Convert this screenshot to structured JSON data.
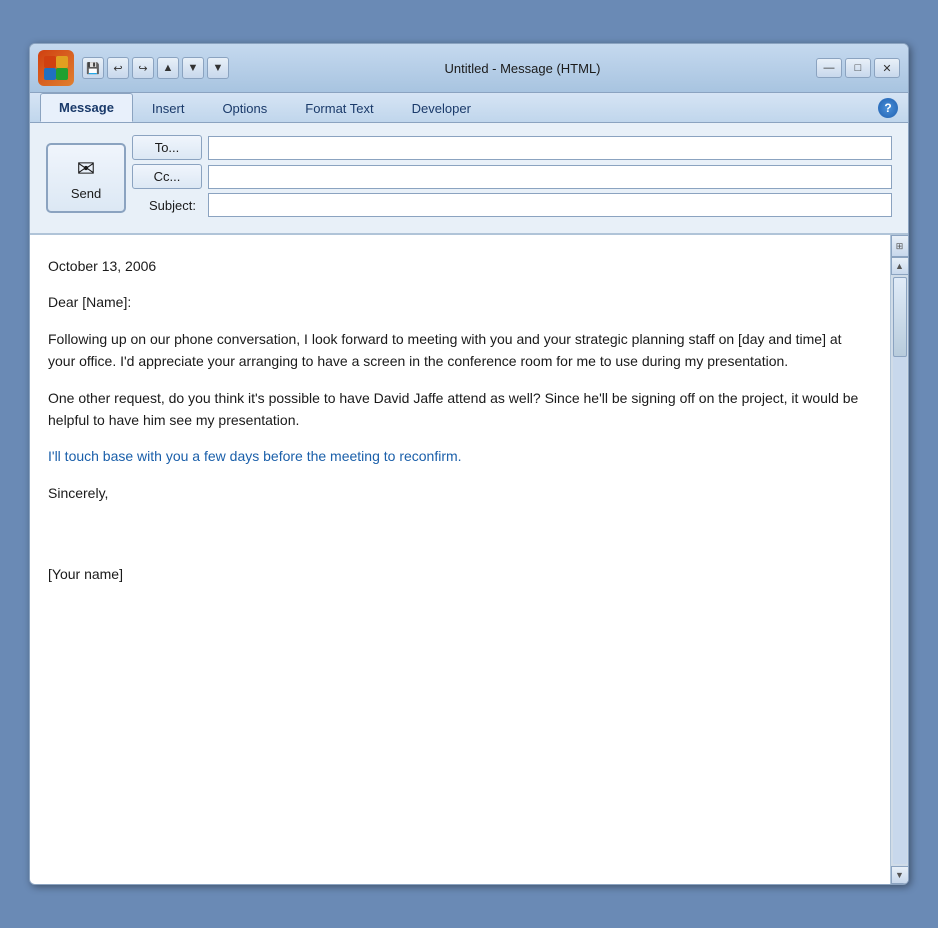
{
  "titlebar": {
    "title": "Untitled - Message (HTML)",
    "undo_label": "↩",
    "redo_label": "↪",
    "up_label": "▲",
    "down_label": "▼",
    "pin_label": "▼",
    "minimize_label": "—",
    "maximize_label": "□",
    "close_label": "✕"
  },
  "tabs": [
    {
      "id": "message",
      "label": "Message",
      "active": true
    },
    {
      "id": "insert",
      "label": "Insert",
      "active": false
    },
    {
      "id": "options",
      "label": "Options",
      "active": false
    },
    {
      "id": "format-text",
      "label": "Format Text",
      "active": false
    },
    {
      "id": "developer",
      "label": "Developer",
      "active": false
    }
  ],
  "help_label": "?",
  "form": {
    "to_label": "To...",
    "cc_label": "Cc...",
    "subject_label": "Subject:",
    "to_value": "",
    "cc_value": "",
    "subject_value": ""
  },
  "send_button": {
    "icon": "✉",
    "label": "Send"
  },
  "body": {
    "date": "October 13, 2006",
    "greeting": "Dear [Name]:",
    "paragraph1": "Following up on our phone conversation, I look forward to meeting with you and your strategic planning staff on [day and time] at your office. I'd appreciate your arranging to have a screen in the conference room for me to use during my presentation.",
    "paragraph2": "One other request, do you think it's possible to have David Jaffe attend as well? Since he'll be signing off on the project, it would be helpful to have him see my presentation.",
    "paragraph3": "I'll touch base with you a few days before the meeting to reconfirm.",
    "closing": "Sincerely,",
    "signature": "[Your name]"
  }
}
